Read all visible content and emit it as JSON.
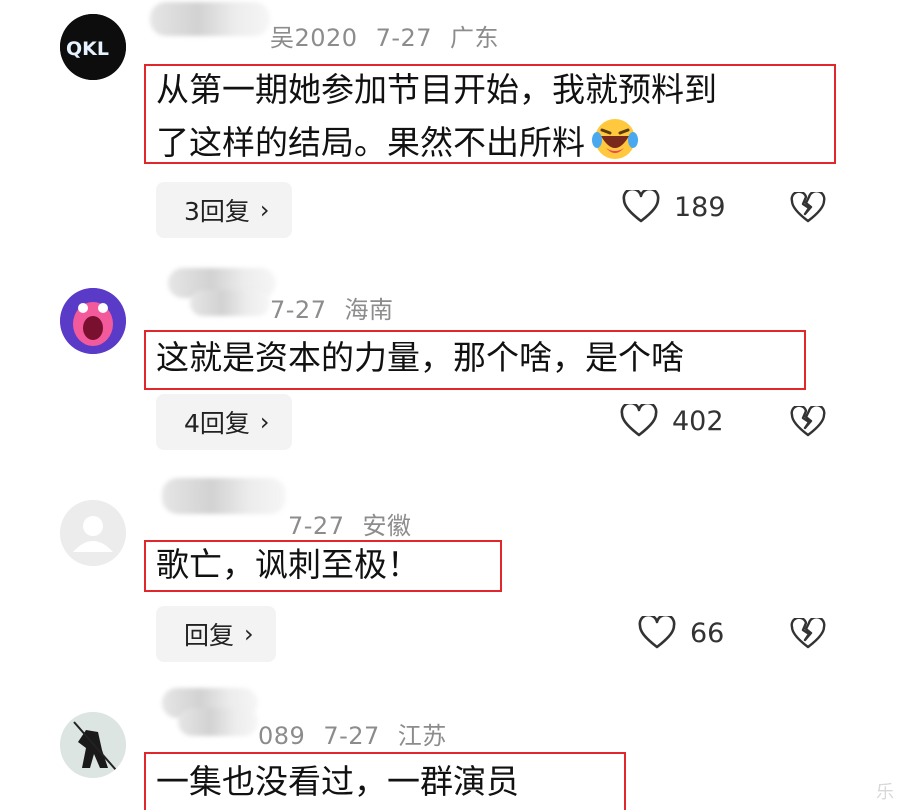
{
  "comments": [
    {
      "user_suffix": "吴2020",
      "date": "7-27",
      "region": "广东",
      "text_line1": "从第一期她参加节目开始，我就预料到",
      "text_line2": "了这样的结局。果然不出所料",
      "reply_label": "3回复",
      "likes": "189"
    },
    {
      "user_suffix": "",
      "date": "7-27",
      "region": "海南",
      "text_line1": "这就是资本的力量，那个啥，是个啥",
      "reply_label": "4回复",
      "likes": "402"
    },
    {
      "user_suffix": "",
      "date": "7-27",
      "region": "安徽",
      "text_line1": "歌亡，讽刺至极！",
      "reply_label": "回复",
      "likes": "66"
    },
    {
      "user_suffix": "089",
      "date": "7-27",
      "region": "江苏",
      "text_line1": "一集也没看过，一群演员"
    }
  ],
  "icons": {
    "like": "heart-outline-icon",
    "dislike": "broken-heart-icon",
    "chevron": "chevron-right-icon",
    "emoji": "laugh-cry-emoji"
  },
  "colors": {
    "highlight_border": "#e0272c",
    "meta_gray": "#8c8c8c",
    "button_bg": "#f3f3f3"
  },
  "watermark": "乐"
}
